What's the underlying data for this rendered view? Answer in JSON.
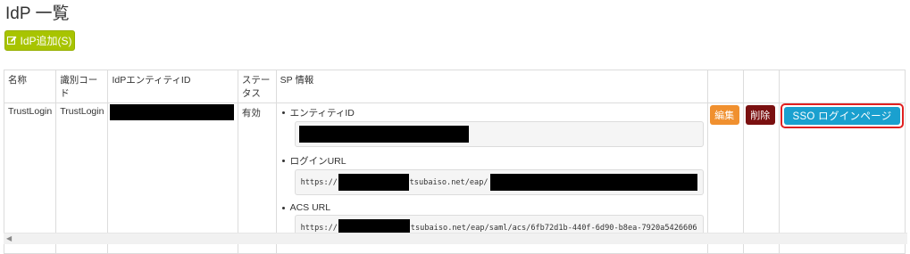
{
  "page": {
    "title": "IdP 一覧"
  },
  "toolbar": {
    "add_label": "IdP追加(S)",
    "add_icon": "edit-icon"
  },
  "table": {
    "headers": [
      "名称",
      "識別コード",
      "IdPエンティティID",
      "ステータス",
      "SP 情報",
      "",
      "",
      ""
    ],
    "row": {
      "name": "TrustLogin",
      "code": "TrustLogin",
      "status": "有効",
      "sp": {
        "entity_label": "エンティティID",
        "login_label": "ログインURL",
        "login_prefix": "https://",
        "login_mid": "tsubaiso.net/eap/",
        "acs_label": "ACS URL",
        "acs_prefix": "https://",
        "acs_mid": "tsubaiso.net/eap/saml/acs/6fb72d1b-440f-6d90-b8ea-7920a5426606"
      },
      "edit_label": "編集",
      "delete_label": "削除",
      "sso_label": "SSO ログインページ"
    }
  },
  "colors": {
    "add_button": "#a8c400",
    "edit_button": "#f0902f",
    "delete_button": "#7a1010",
    "sso_button": "#1aa0cf",
    "highlight_border": "#e02020"
  }
}
